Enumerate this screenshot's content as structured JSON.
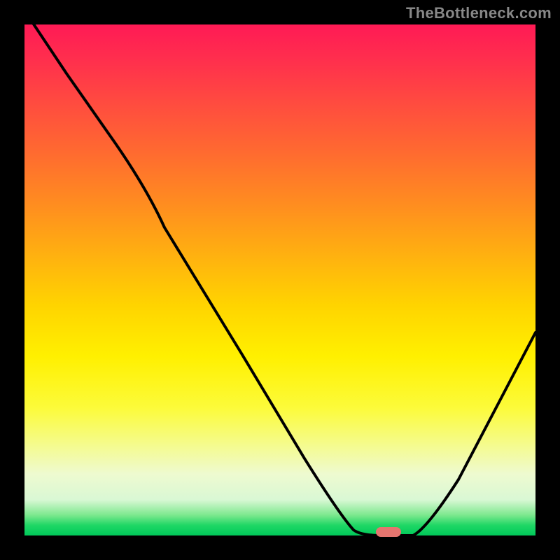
{
  "watermark": {
    "text": "TheBottleneck.com"
  },
  "colors": {
    "frame": "#000000",
    "curve": "#000000",
    "marker": "#e5756f",
    "watermark": "#888888"
  },
  "chart_data": {
    "type": "line",
    "title": "",
    "xlabel": "",
    "ylabel": "",
    "x_range": [
      0,
      100
    ],
    "y_range": [
      0,
      100
    ],
    "x": [
      0,
      5,
      10,
      15,
      20,
      24,
      28,
      35,
      42,
      50,
      57,
      62,
      65,
      68,
      72,
      78,
      84,
      90,
      95,
      100
    ],
    "y": [
      103,
      94,
      85,
      76,
      68,
      62,
      56,
      44,
      33,
      21,
      10,
      3,
      0.5,
      0,
      0,
      6,
      15,
      25,
      33,
      42
    ],
    "marker": {
      "x": 70,
      "y": 0
    },
    "background_gradient": [
      {
        "stop": 0.0,
        "color": "#ff1a55"
      },
      {
        "stop": 0.3,
        "color": "#ff7a28"
      },
      {
        "stop": 0.6,
        "color": "#ffe000"
      },
      {
        "stop": 0.88,
        "color": "#f0fbc0"
      },
      {
        "stop": 1.0,
        "color": "#00c95a"
      }
    ]
  }
}
